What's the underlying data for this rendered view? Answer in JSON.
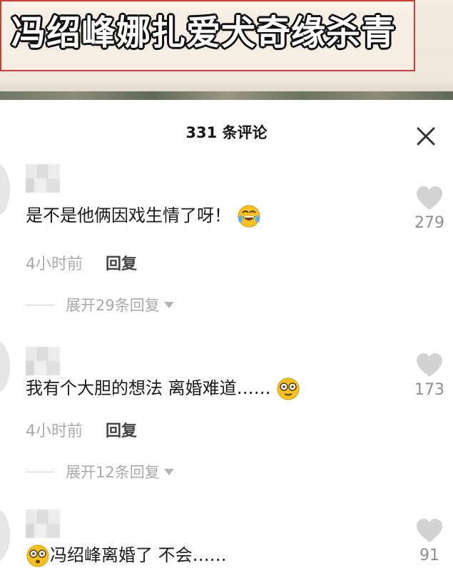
{
  "banner": {
    "title": "冯绍峰娜扎爱犬奇缘杀青"
  },
  "header": {
    "comment_count_label": "331 条评论"
  },
  "comments": [
    {
      "text": "是不是他俩因戏生情了呀！",
      "emoji": "rofl-emoji",
      "time": "4小时前",
      "reply_label": "回复",
      "expand_label": "展开29条回复",
      "likes": "279"
    },
    {
      "text": "我有个大胆的想法 离婚难道……",
      "emoji": "dizzy-face-emoji",
      "time": "4小时前",
      "reply_label": "回复",
      "expand_label": "展开12条回复",
      "likes": "173"
    },
    {
      "text": "冯绍峰离婚了 不会……",
      "emoji": "dizzy-face-emoji",
      "likes": "91"
    }
  ],
  "colors": {
    "banner_border": "#d63a36",
    "text": "#1a1a1a",
    "muted": "#a9a9a9",
    "heart": "#d3d3d3"
  }
}
